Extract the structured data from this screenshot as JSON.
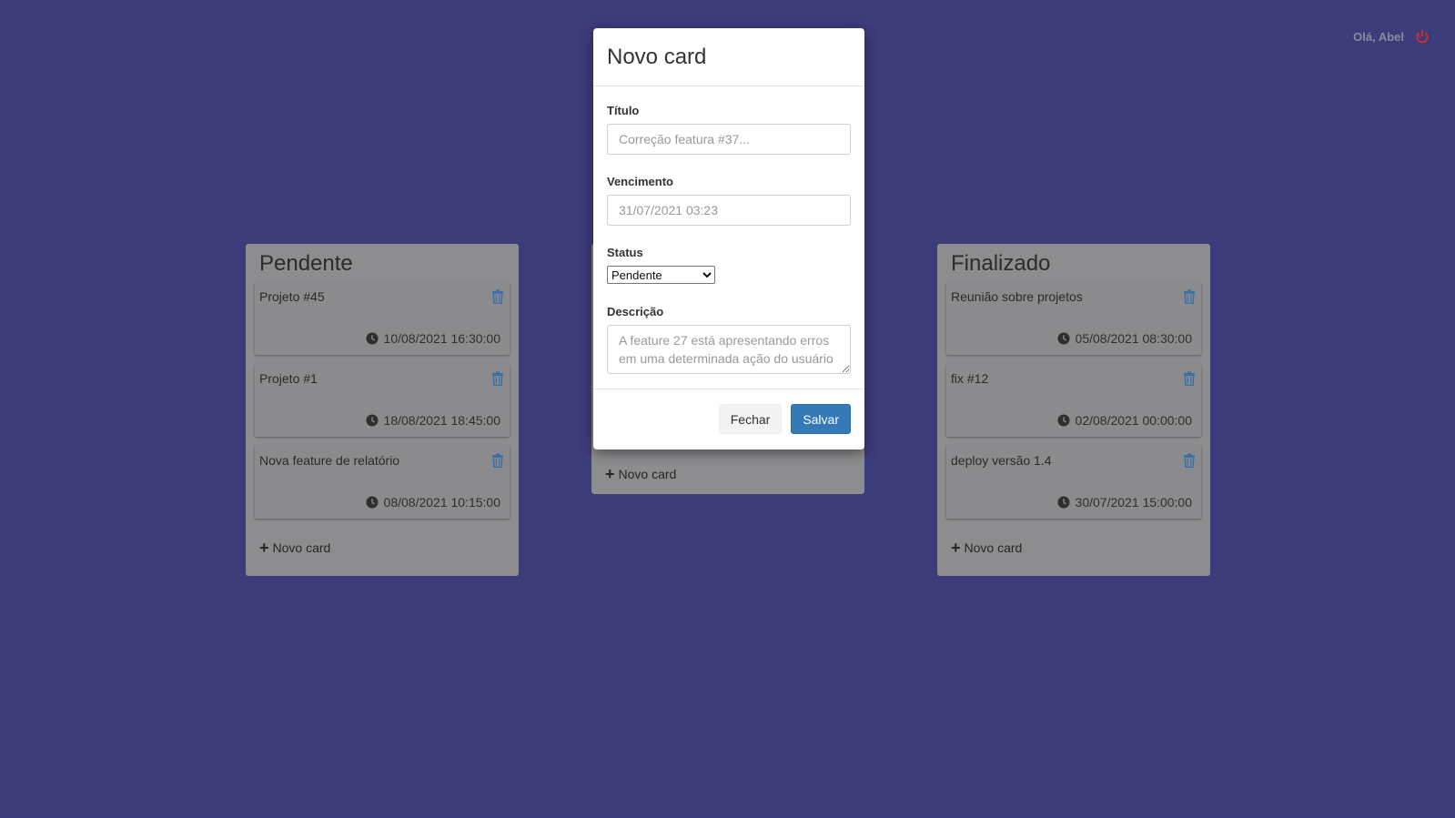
{
  "header": {
    "greeting": "Olá, Abel"
  },
  "columns": [
    {
      "title": "Pendente",
      "cards": [
        {
          "title": "Projeto #45",
          "due": "10/08/2021 16:30:00"
        },
        {
          "title": "Projeto #1",
          "due": "18/08/2021 18:45:00"
        },
        {
          "title": "Nova feature de relatório",
          "due": "08/08/2021 10:15:00"
        }
      ],
      "add_label": "Novo card"
    },
    {
      "title": "",
      "cards": [],
      "add_label": "Novo card"
    },
    {
      "title": "Finalizado",
      "cards": [
        {
          "title": "Reunião sobre projetos",
          "due": "05/08/2021 08:30:00"
        },
        {
          "title": "fix #12",
          "due": "02/08/2021 00:00:00"
        },
        {
          "title": "deploy versão 1.4",
          "due": "30/07/2021 15:00:00"
        }
      ],
      "add_label": "Novo card"
    }
  ],
  "modal": {
    "title": "Novo card",
    "titulo_label": "Título",
    "titulo_placeholder": "Correção featura #37...",
    "vencimento_label": "Vencimento",
    "vencimento_placeholder": "31/07/2021 03:23",
    "status_label": "Status",
    "status_selected": "Pendente",
    "descricao_label": "Descrição",
    "descricao_placeholder": "A feature 27 está apresentando erros em uma determinada ação do usuário",
    "close_label": "Fechar",
    "save_label": "Salvar"
  },
  "colors": {
    "background": "#3d3c7b",
    "column": "#8d8d8f",
    "accent": "#337ab7",
    "logout": "#c9302c"
  }
}
